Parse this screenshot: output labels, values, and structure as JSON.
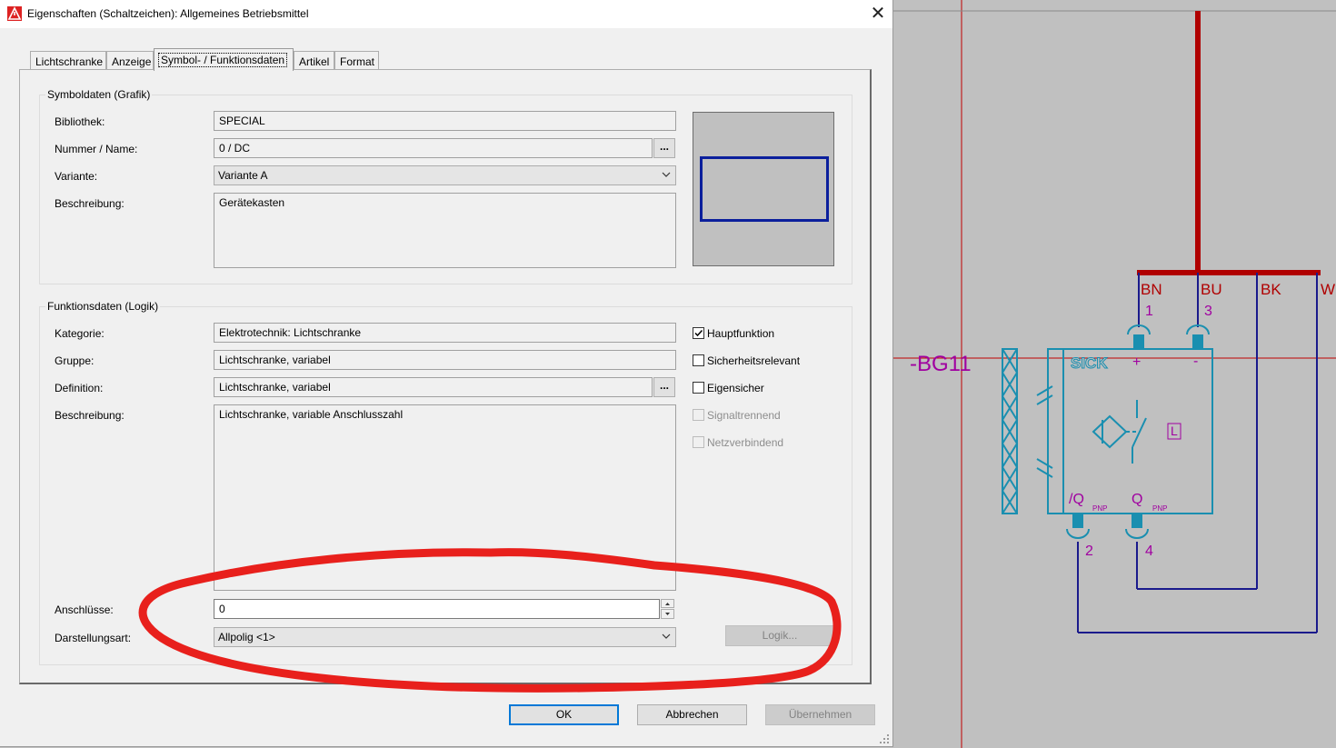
{
  "window": {
    "title": "Eigenschaften (Schaltzeichen): Allgemeines Betriebsmittel",
    "close_icon": "close-icon"
  },
  "tabs": [
    {
      "label": "Lichtschranke"
    },
    {
      "label": "Anzeige"
    },
    {
      "label": "Symbol- / Funktionsdaten",
      "active": true
    },
    {
      "label": "Artikel"
    },
    {
      "label": "Format"
    }
  ],
  "symbol_group": {
    "title": "Symboldaten (Grafik)",
    "library_label": "Bibliothek:",
    "library_value": "SPECIAL",
    "number_label": "Nummer / Name:",
    "number_value": "0 / DC",
    "number_button": "...",
    "variant_label": "Variante:",
    "variant_value": "Variante A",
    "description_label": "Beschreibung:",
    "description_value": "Gerätekasten"
  },
  "function_group": {
    "title": "Funktionsdaten (Logik)",
    "category_label": "Kategorie:",
    "category_value": "Elektrotechnik: Lichtschranke",
    "group_label": "Gruppe:",
    "group_value": "Lichtschranke, variabel",
    "definition_label": "Definition:",
    "definition_value": "Lichtschranke, variabel",
    "definition_button": "...",
    "description_label": "Beschreibung:",
    "description_value": "Lichtschranke, variable Anschlusszahl",
    "connections_label": "Anschlüsse:",
    "connections_value": "0",
    "representation_label": "Darstellungsart:",
    "representation_value": "Allpolig <1>",
    "logic_button": "Logik...",
    "checkboxes": [
      {
        "label": "Hauptfunktion",
        "checked": true,
        "enabled": true
      },
      {
        "label": "Sicherheitsrelevant",
        "checked": false,
        "enabled": true
      },
      {
        "label": "Eigensicher",
        "checked": false,
        "enabled": true
      },
      {
        "label": "Signaltrennend",
        "checked": false,
        "enabled": false
      },
      {
        "label": "Netzverbindend",
        "checked": false,
        "enabled": false
      }
    ]
  },
  "buttons": {
    "ok": "OK",
    "cancel": "Abbrechen",
    "apply": "Übernehmen"
  },
  "schematic": {
    "device_tag": "-BG11",
    "wire_labels": [
      "BN",
      "BU",
      "BK",
      "W"
    ],
    "pin_numbers_top": [
      "1",
      "3"
    ],
    "pin_numbers_bottom": [
      "2",
      "4"
    ],
    "pin_signs": [
      "+",
      "-"
    ],
    "output_labels": [
      "/Q",
      "Q"
    ],
    "output_suffix": "PNP",
    "brand": "SICK",
    "l_marker": "L",
    "colors": {
      "wire_red": "#b00000",
      "device_cyan": "#1a8fb0",
      "label_magenta": "#a000a0",
      "wire_blue": "#1a1a8c",
      "annotation_red": "#e8201c"
    }
  }
}
